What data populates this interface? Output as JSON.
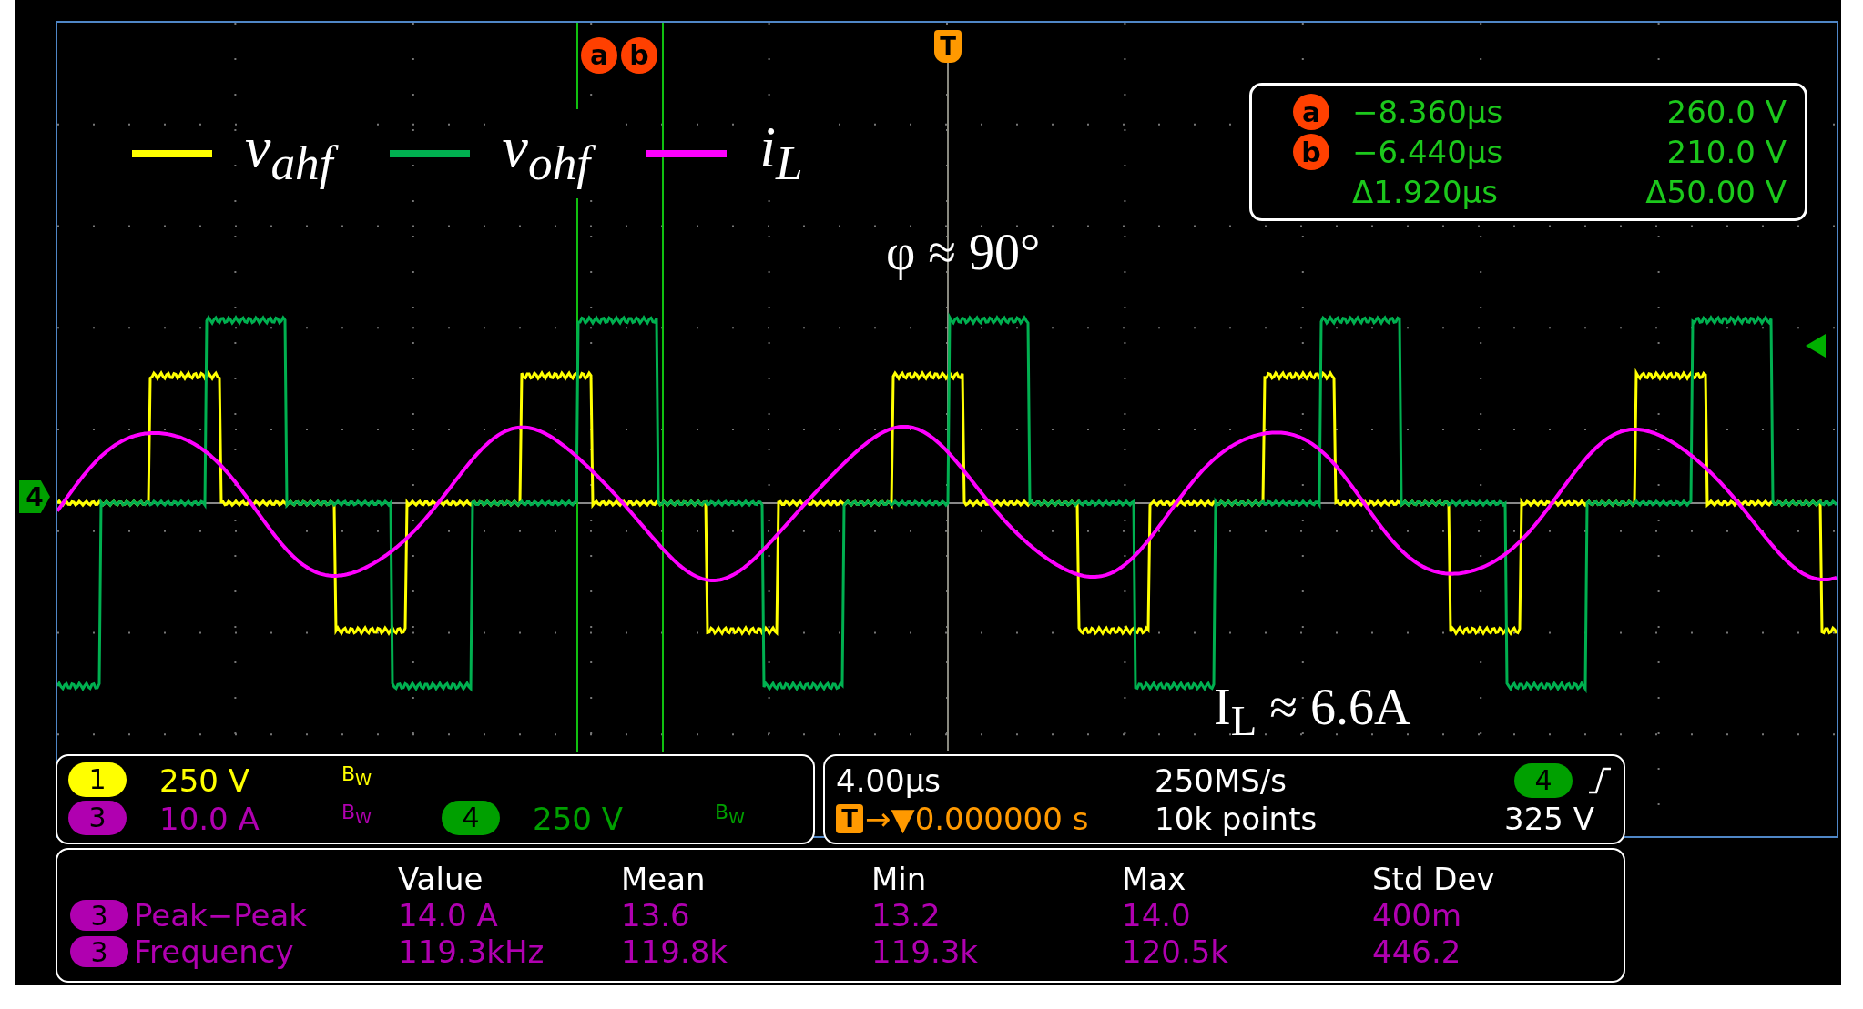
{
  "legend": [
    {
      "label": "v$_{ahf}$",
      "color": "#ffff00"
    },
    {
      "label": "v$_{ohf}$",
      "color": "#00b050"
    },
    {
      "label": "i$_{L}$",
      "color": "#ff00ff"
    }
  ],
  "annotations": [
    {
      "kind": "phase",
      "text": "φ ≈ 90°"
    },
    {
      "kind": "current",
      "text": "I$_{L}$ ≈ 6.6A"
    }
  ],
  "cursor_markers": [
    "a",
    "b"
  ],
  "trigger_marker": "T",
  "ground_marker": "4",
  "cursor_readout": [
    {
      "marker": "a",
      "time": "−8.360µs",
      "value": "260.0 V"
    },
    {
      "marker": "b",
      "time": "−6.440µs",
      "value": "210.0 V"
    },
    {
      "time": "Δ1.920µs",
      "value": "Δ50.00 V"
    }
  ],
  "channels": [
    {
      "number": "1",
      "scale": "250 V",
      "bandwidth": "B$_{W}$",
      "color": "#ffff00"
    },
    {
      "number": "3",
      "scale": "10.0 A",
      "bandwidth": "B$_{W}$",
      "color": "#b000b0"
    },
    {
      "number": "4",
      "scale": "250 V",
      "bandwidth": "B$_{W}$",
      "color": "#00a000"
    }
  ],
  "timebase": {
    "scale": "4.00µs",
    "sample_rate": "250MS/s",
    "trigger_badge": "T",
    "delay": "→▼0.000000 s",
    "record_length": "10k points",
    "trigger_source": "4",
    "trigger_level": "325 V"
  },
  "measurements": {
    "columns": [
      "Value",
      "Mean",
      "Min",
      "Max",
      "Std Dev"
    ],
    "rows": [
      {
        "source": "3",
        "name": "Peak−Peak",
        "values": [
          "14.0 A",
          "13.6",
          "13.2",
          "14.0",
          "400m"
        ]
      },
      {
        "source": "3",
        "name": "Frequency",
        "values": [
          "119.3kHz",
          "119.8k",
          "119.3k",
          "120.5k",
          "446.2"
        ]
      }
    ]
  }
}
